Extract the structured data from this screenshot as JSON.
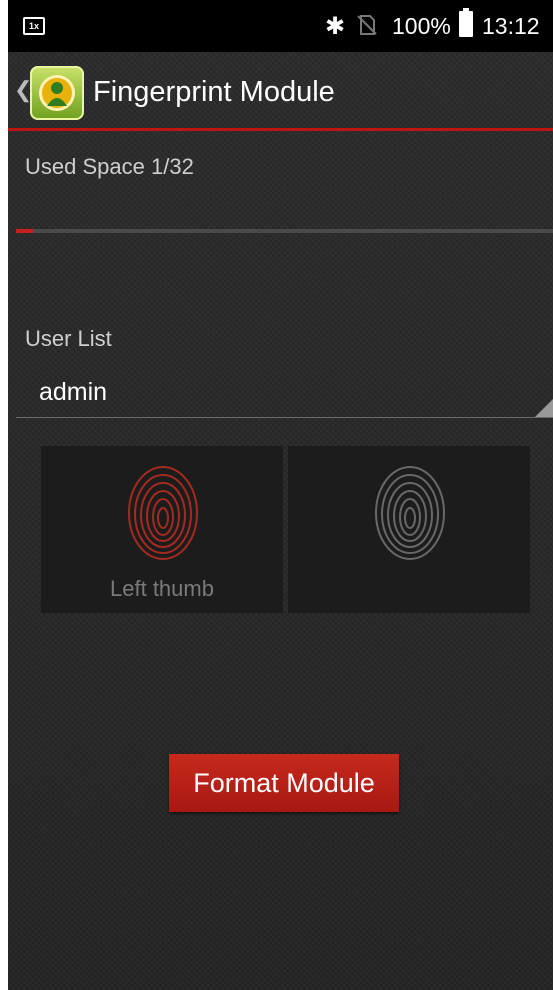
{
  "status_bar": {
    "notification_icon": "image-notification-icon",
    "notification_glyph": "1x",
    "bluetooth_icon": "bluetooth-icon",
    "no_sim_icon": "no-sim-icon",
    "battery_percent": "100%",
    "time": "13:12"
  },
  "app_bar": {
    "title": "Fingerprint Module",
    "back_icon": "chevron-left-icon",
    "app_icon": "app-user-icon"
  },
  "storage": {
    "used_space_label": "Used Space",
    "used_space_value": "1/32",
    "used_fraction": 0.03125
  },
  "user_list": {
    "label": "User List",
    "selected": "admin"
  },
  "fingers": [
    {
      "label": "Left thumb",
      "state": "enrolled",
      "color": "#b32b22"
    },
    {
      "label": "",
      "state": "not-enrolled",
      "color": "#6b6b6b"
    }
  ],
  "actions": {
    "format_label": "Format Module"
  },
  "colors": {
    "accent": "#c01515",
    "button": "#b8201a"
  }
}
